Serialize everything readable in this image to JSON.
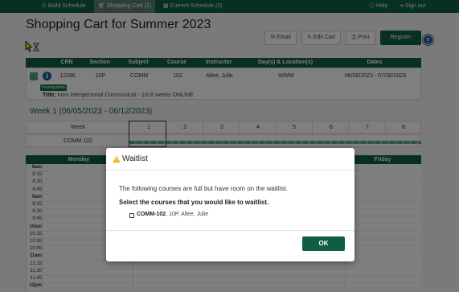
{
  "nav": {
    "items": [
      {
        "label": "Build Schedule",
        "icon": "clock-icon"
      },
      {
        "label": "Shopping Cart (1)",
        "icon": "cart-icon",
        "active": true
      },
      {
        "label": "Current Schedule (0)",
        "icon": "calendar-icon"
      }
    ],
    "help": "Help",
    "signout": "Sign out"
  },
  "page": {
    "title": "Shopping Cart for Summer 2023",
    "buttons": {
      "email": "Email",
      "edit_cart": "Edit Cart",
      "print": "Print",
      "register": "Register",
      "help": "?"
    }
  },
  "cart": {
    "headers": [
      "CRN",
      "Section",
      "Subject",
      "Course",
      "Instructor",
      "Day(s) & Location(s)",
      "Dates"
    ],
    "row": {
      "crn": "12286",
      "section": "10P",
      "subject": "COMM",
      "course": "102",
      "instructor": "Allee, Julie",
      "days_location": "WWW",
      "dates": "06/05/2023 - 07/30/2023",
      "badge": "Prerequisites",
      "title_label": "Title:",
      "title_value": "Intro Interpersonal Communicat - 1st 8 weeks ONLINE"
    }
  },
  "week": {
    "label": "Week 1 (06/05/2023 - 06/12/2023)",
    "header": "Week",
    "numbers": [
      "1",
      "2",
      "3",
      "4",
      "5",
      "6",
      "7",
      "8"
    ],
    "course_row": "COMM 102"
  },
  "calendar": {
    "days": [
      "Monday",
      "Friday"
    ],
    "times": [
      "8am",
      "8:15",
      "8:30",
      "8:45",
      "9am",
      "9:15",
      "9:30",
      "9:45",
      "10am",
      "10:15",
      "10:30",
      "10:45",
      "11am",
      "11:15",
      "11:30",
      "11:45",
      "12pm"
    ]
  },
  "modal": {
    "title": "Waitlist",
    "line1": "The following courses are full but have room on the waitlist.",
    "line2": "Select the courses that you would like to waitlist.",
    "course_bold": "COMM-102",
    "course_rest": ", 10P, Allee, Julie",
    "ok": "OK"
  },
  "colors": {
    "brand": "#0e5e44",
    "info": "#1f5a96",
    "warning": "#f0b400"
  }
}
